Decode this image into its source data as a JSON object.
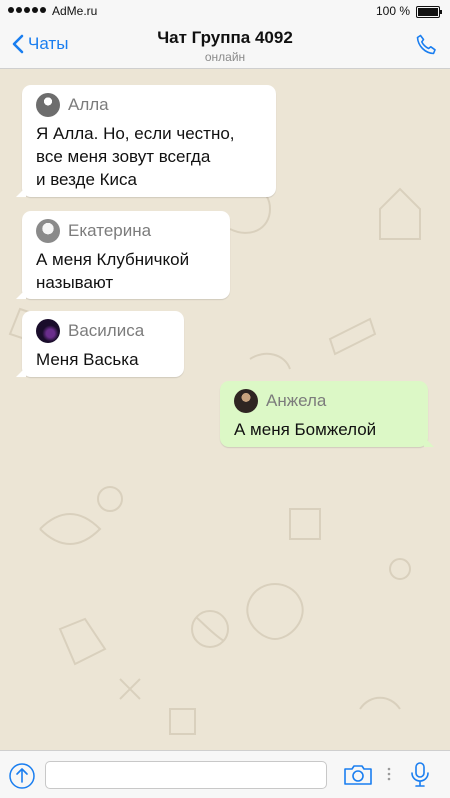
{
  "status_bar": {
    "carrier": "AdMe.ru",
    "battery": "100 %"
  },
  "nav": {
    "back_label": "Чаты",
    "title": "Чат Группа 4092",
    "subtitle": "онлайн"
  },
  "messages": [
    {
      "sender": "Алла",
      "text": "Я Алла. Но, если честно,\nвсе меня зовут всегда\nи везде Киса",
      "direction": "incoming"
    },
    {
      "sender": "Екатерина",
      "text": "А меня Клубничкой\nназывают",
      "direction": "incoming"
    },
    {
      "sender": "Василиса",
      "text": "Меня Васька",
      "direction": "incoming"
    },
    {
      "sender": "Анжела",
      "text": "А меня Бомжелой",
      "direction": "outgoing"
    }
  ],
  "input": {
    "placeholder": "",
    "value": ""
  },
  "icons": {
    "back": "chevron-left-icon",
    "call": "phone-icon",
    "upload": "upload-icon",
    "camera": "camera-icon",
    "mic": "microphone-icon"
  },
  "colors": {
    "accent": "#1a7ef0",
    "chat_background": "#ece5d5",
    "incoming_bubble": "#ffffff",
    "outgoing_bubble": "#dcf8c6"
  }
}
